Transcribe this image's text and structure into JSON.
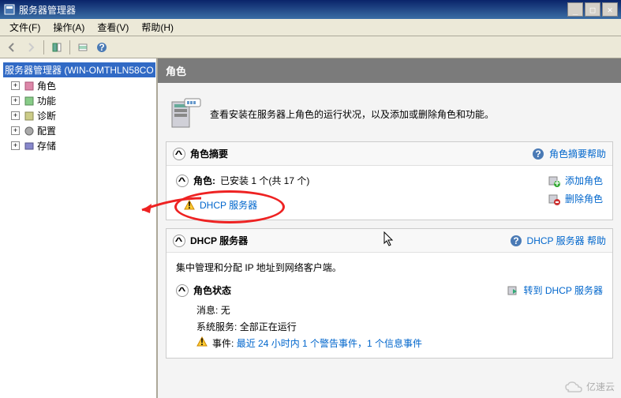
{
  "window": {
    "title": "服务器管理器"
  },
  "menu": {
    "file": "文件(F)",
    "action": "操作(A)",
    "view": "查看(V)",
    "help": "帮助(H)"
  },
  "tree": {
    "root": "服务器管理器 (WIN-OMTHLN58CO",
    "roles": "角色",
    "features": "功能",
    "diagnostics": "诊断",
    "config": "配置",
    "storage": "存储"
  },
  "header": "角色",
  "intro": "查看安装在服务器上角色的运行状况，以及添加或删除角色和功能。",
  "summary": {
    "title": "角色摘要",
    "help": "角色摘要帮助",
    "roles_label": "角色:",
    "roles_installed": "已安装 1 个(共 17 个)",
    "add_role": "添加角色",
    "remove_role": "删除角色",
    "dhcp_role": "DHCP 服务器"
  },
  "dhcp": {
    "title": "DHCP 服务器",
    "help": "DHCP 服务器 帮助",
    "desc": "集中管理和分配 IP 地址到网络客户端。",
    "status_title": "角色状态",
    "goto": "转到 DHCP 服务器",
    "msg_label": "消息:",
    "msg_val": "无",
    "svc_label": "系统服务:",
    "svc_val": "全部正在运行",
    "evt_label": "事件:",
    "evt_val": "最近 24 小时内 1 个警告事件，1 个信息事件"
  },
  "watermark": "亿速云"
}
